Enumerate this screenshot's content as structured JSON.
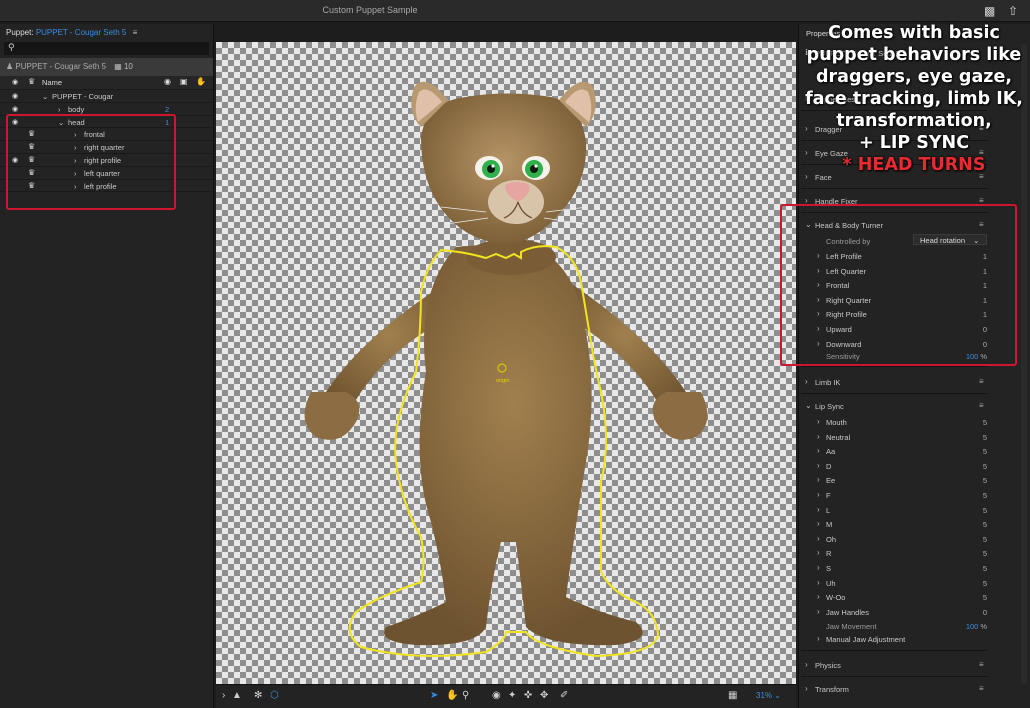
{
  "window": {
    "title": "Custom Puppet Sample"
  },
  "puppet_panel": {
    "label": "Puppet:",
    "puppet_name": "PUPPET - Cougar Seth 5",
    "menu_icon": "menu-icon",
    "breadcrumb": "PUPPET - Cougar Seth 5",
    "count": "10",
    "name_header": "Name",
    "rows": [
      {
        "label": "PUPPET - Cougar",
        "eye": true,
        "indent": 1,
        "num": ""
      },
      {
        "label": "body",
        "eye": true,
        "indent": 2,
        "num": "2"
      },
      {
        "label": "head",
        "eye": true,
        "indent": 2,
        "num": "1"
      },
      {
        "label": "frontal",
        "eye": false,
        "indent": 3,
        "num": ""
      },
      {
        "label": "right quarter",
        "eye": false,
        "indent": 3,
        "num": ""
      },
      {
        "label": "right profile",
        "eye": true,
        "indent": 3,
        "num": ""
      },
      {
        "label": "left quarter",
        "eye": false,
        "indent": 3,
        "num": ""
      },
      {
        "label": "left profile",
        "eye": false,
        "indent": 3,
        "num": ""
      }
    ]
  },
  "canvas": {
    "origin_label": "origin",
    "zoom": "31%"
  },
  "properties": {
    "title": "Properties",
    "puppet_row": "PUPPET - Cougar Seth 5",
    "sections_top": [
      {
        "label": "Puppet Mesh"
      },
      {
        "label": "Dragger"
      },
      {
        "label": "Eye Gaze"
      },
      {
        "label": "Face"
      },
      {
        "label": "Handle Fixer"
      }
    ],
    "head_body": {
      "label": "Head & Body Turner",
      "controlled_by_label": "Controlled by",
      "controlled_by_value": "Head rotation",
      "items": [
        {
          "label": "Left Profile",
          "value": "1"
        },
        {
          "label": "Left Quarter",
          "value": "1"
        },
        {
          "label": "Frontal",
          "value": "1"
        },
        {
          "label": "Right Quarter",
          "value": "1"
        },
        {
          "label": "Right Profile",
          "value": "1"
        },
        {
          "label": "Upward",
          "value": "0"
        },
        {
          "label": "Downward",
          "value": "0"
        }
      ],
      "sensitivity_label": "Sensitivity",
      "sensitivity_value": "100",
      "sensitivity_unit": "%"
    },
    "limb_ik": {
      "label": "Limb IK"
    },
    "lip_sync": {
      "label": "Lip Sync",
      "items": [
        {
          "label": "Mouth",
          "value": "5"
        },
        {
          "label": "Neutral",
          "value": "5"
        },
        {
          "label": "Aa",
          "value": "5"
        },
        {
          "label": "D",
          "value": "5"
        },
        {
          "label": "Ee",
          "value": "5"
        },
        {
          "label": "F",
          "value": "5"
        },
        {
          "label": "L",
          "value": "5"
        },
        {
          "label": "M",
          "value": "5"
        },
        {
          "label": "Oh",
          "value": "5"
        },
        {
          "label": "R",
          "value": "5"
        },
        {
          "label": "S",
          "value": "5"
        },
        {
          "label": "Uh",
          "value": "5"
        },
        {
          "label": "W-Oo",
          "value": "5"
        },
        {
          "label": "Jaw Handles",
          "value": "0"
        }
      ],
      "jaw_movement_label": "Jaw Movement",
      "jaw_movement_value": "100",
      "jaw_movement_unit": "%",
      "manual_jaw_label": "Manual Jaw Adjustment"
    },
    "physics": {
      "label": "Physics"
    },
    "transform": {
      "label": "Transform"
    }
  },
  "callout": {
    "line1": "Comes with basic",
    "line2": "puppet behaviors like",
    "line3": "draggers, eye gaze,",
    "line4": "face tracking, limb IK,",
    "line5": "transformation,",
    "line6": "+ LIP SYNC",
    "line7": "* HEAD TURNS"
  },
  "colors": {
    "accent": "#3a8dde",
    "annotation_red": "#d0162e",
    "mesh_yellow": "#f2e41c"
  }
}
